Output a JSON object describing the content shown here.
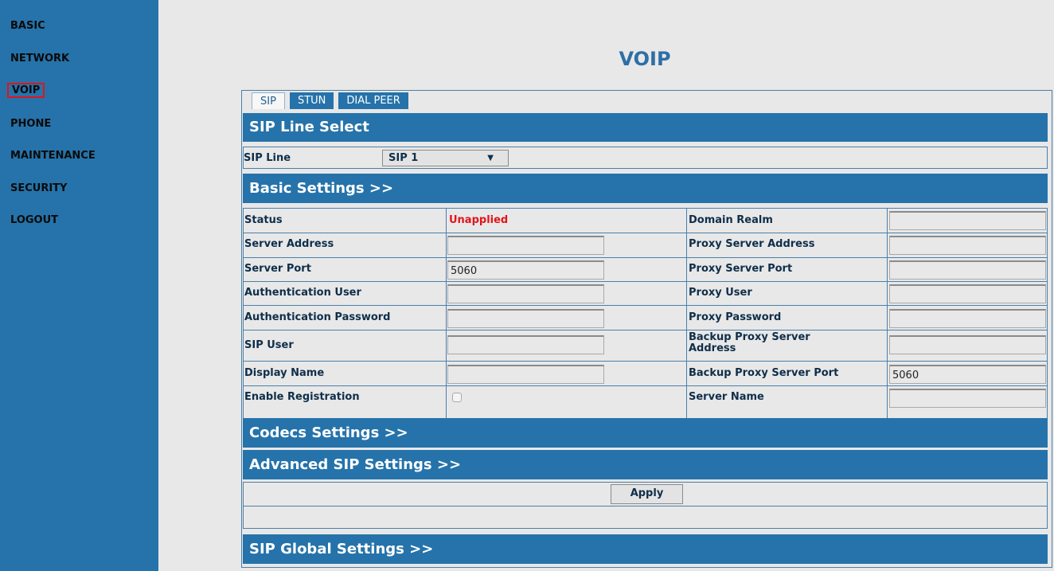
{
  "nav": {
    "items": [
      "BASIC",
      "NETWORK",
      "VOIP",
      "PHONE",
      "MAINTENANCE",
      "SECURITY",
      "LOGOUT"
    ],
    "active": "VOIP",
    "active_outline_color": "#e0151b",
    "bg_color": "#2573aa"
  },
  "page": {
    "title": "VOIP"
  },
  "tabs": {
    "sip": "SIP",
    "stun": "STUN",
    "dial_peer": "DIAL PEER",
    "active": "SIP"
  },
  "line_select": {
    "header": "SIP Line Select",
    "label": "SIP Line",
    "value": "SIP 1"
  },
  "basic": {
    "header": "Basic Settings >>",
    "status_label": "Status",
    "status_value": "Unapplied",
    "status_color": "#e0151b",
    "server_address_label": "Server Address",
    "server_address_value": "",
    "server_port_label": "Server Port",
    "server_port_value": "5060",
    "auth_user_label": "Authentication User",
    "auth_user_value": "",
    "auth_password_label": "Authentication Password",
    "auth_password_value": "",
    "sip_user_label": "SIP User",
    "sip_user_value": "",
    "display_name_label": "Display Name",
    "display_name_value": "",
    "enable_registration_label": "Enable Registration",
    "enable_registration_checked": false,
    "domain_realm_label": "Domain Realm",
    "domain_realm_value": "",
    "proxy_address_label": "Proxy Server Address",
    "proxy_address_value": "",
    "proxy_port_label": "Proxy Server Port",
    "proxy_port_value": "",
    "proxy_user_label": "Proxy User",
    "proxy_user_value": "",
    "proxy_password_label": "Proxy Password",
    "proxy_password_value": "",
    "backup_proxy_address_label": "Backup Proxy Server Address",
    "backup_proxy_address_value": "",
    "backup_proxy_port_label": "Backup Proxy Server Port",
    "backup_proxy_port_value": "5060",
    "server_name_label": "Server Name",
    "server_name_value": ""
  },
  "codecs": {
    "header": "Codecs Settings >>"
  },
  "advanced": {
    "header": "Advanced SIP Settings >>"
  },
  "apply": {
    "label": "Apply"
  },
  "global": {
    "header": "SIP Global Settings >>"
  }
}
